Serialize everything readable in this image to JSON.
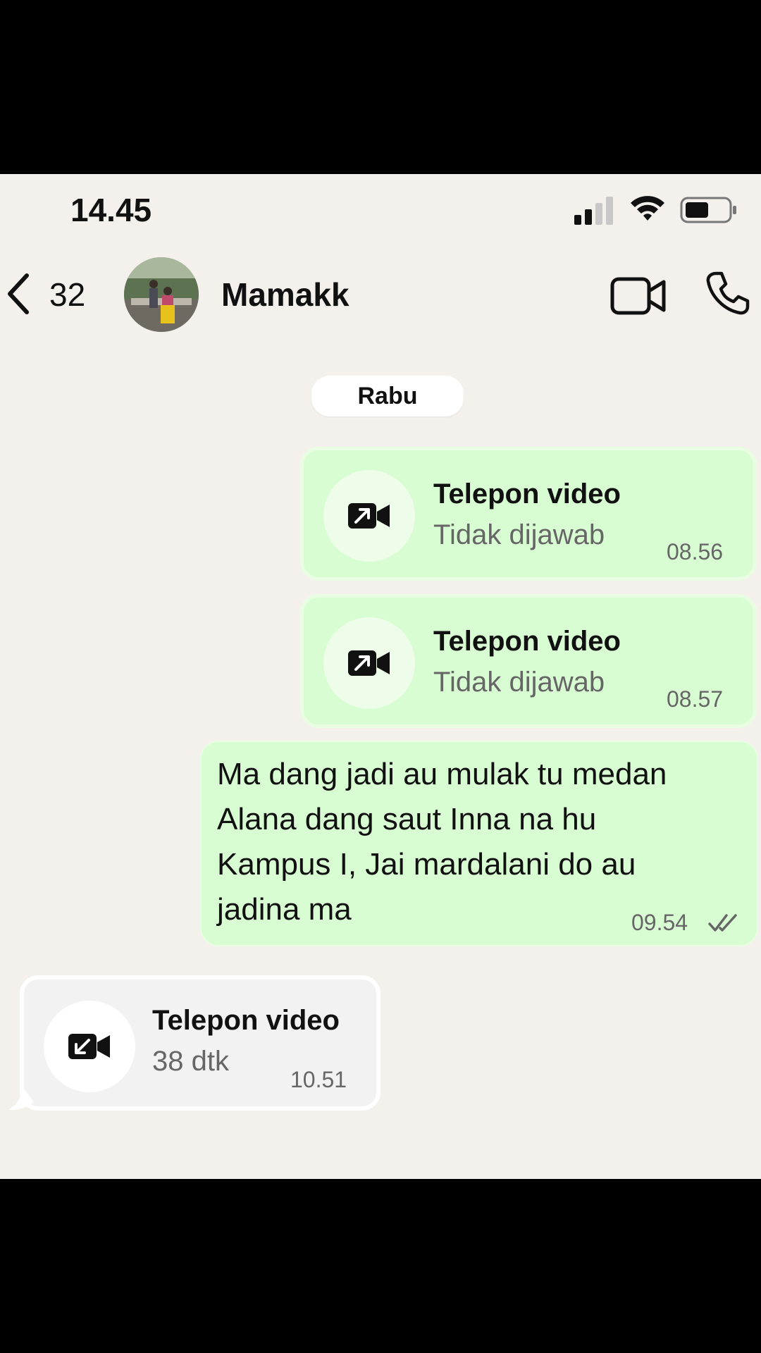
{
  "status_bar": {
    "time": "14.45"
  },
  "header": {
    "back_count": "32",
    "contact_name": "Mamakk"
  },
  "date_chip": "Rabu",
  "messages": [
    {
      "direction": "outgoing",
      "type": "call",
      "title": "Telepon video",
      "subtitle": "Tidak dijawab",
      "time": "08.56",
      "icon": "outgoing-video-call-icon"
    },
    {
      "direction": "outgoing",
      "type": "call",
      "title": "Telepon video",
      "subtitle": "Tidak dijawab",
      "time": "08.57",
      "icon": "outgoing-video-call-icon"
    },
    {
      "direction": "outgoing",
      "type": "text",
      "lines": [
        "Ma dang jadi au mulak tu medan",
        "Alana dang saut Inna na hu",
        "Kampus I, Jai mardalani do au",
        "jadina ma"
      ],
      "time": "09.54",
      "status_icon": "double-check-icon"
    },
    {
      "direction": "incoming",
      "type": "call",
      "title": "Telepon video",
      "subtitle": "38 dtk",
      "time": "10.51",
      "icon": "incoming-video-call-icon"
    }
  ],
  "colors": {
    "chat_background": "#f4f1ed",
    "outgoing_bubble": "#d9fdd3",
    "incoming_bubble": "#f2f2f2",
    "frame": "#000000"
  }
}
